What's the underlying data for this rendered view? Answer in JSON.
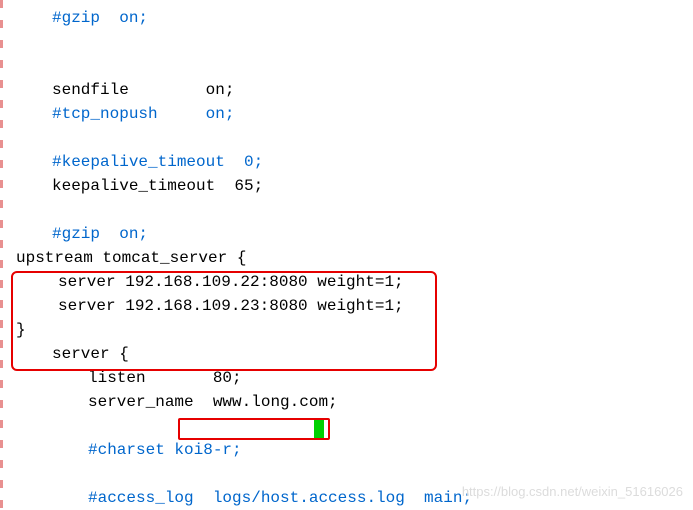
{
  "lines": {
    "l1": "#gzip  on;",
    "l2": "sendfile        on;",
    "l3": "#tcp_nopush     on;",
    "l4": "#keepalive_timeout  0;",
    "l5": "keepalive_timeout  65;",
    "l6": "#gzip  on;",
    "l7": "upstream tomcat_server {",
    "l8": "server 192.168.109.22:8080 weight=1;",
    "l9": "server 192.168.109.23:8080 weight=1;",
    "l10": "}",
    "l11": "server {",
    "l12": "listen       80;",
    "l13a": "server_name  ",
    "l13b": "www.long.com;",
    "l14": "#charset koi8-r;",
    "l15": "#access_log  logs/host.access.log  main;"
  },
  "watermark": "https://blog.csdn.net/weixin_51616026"
}
